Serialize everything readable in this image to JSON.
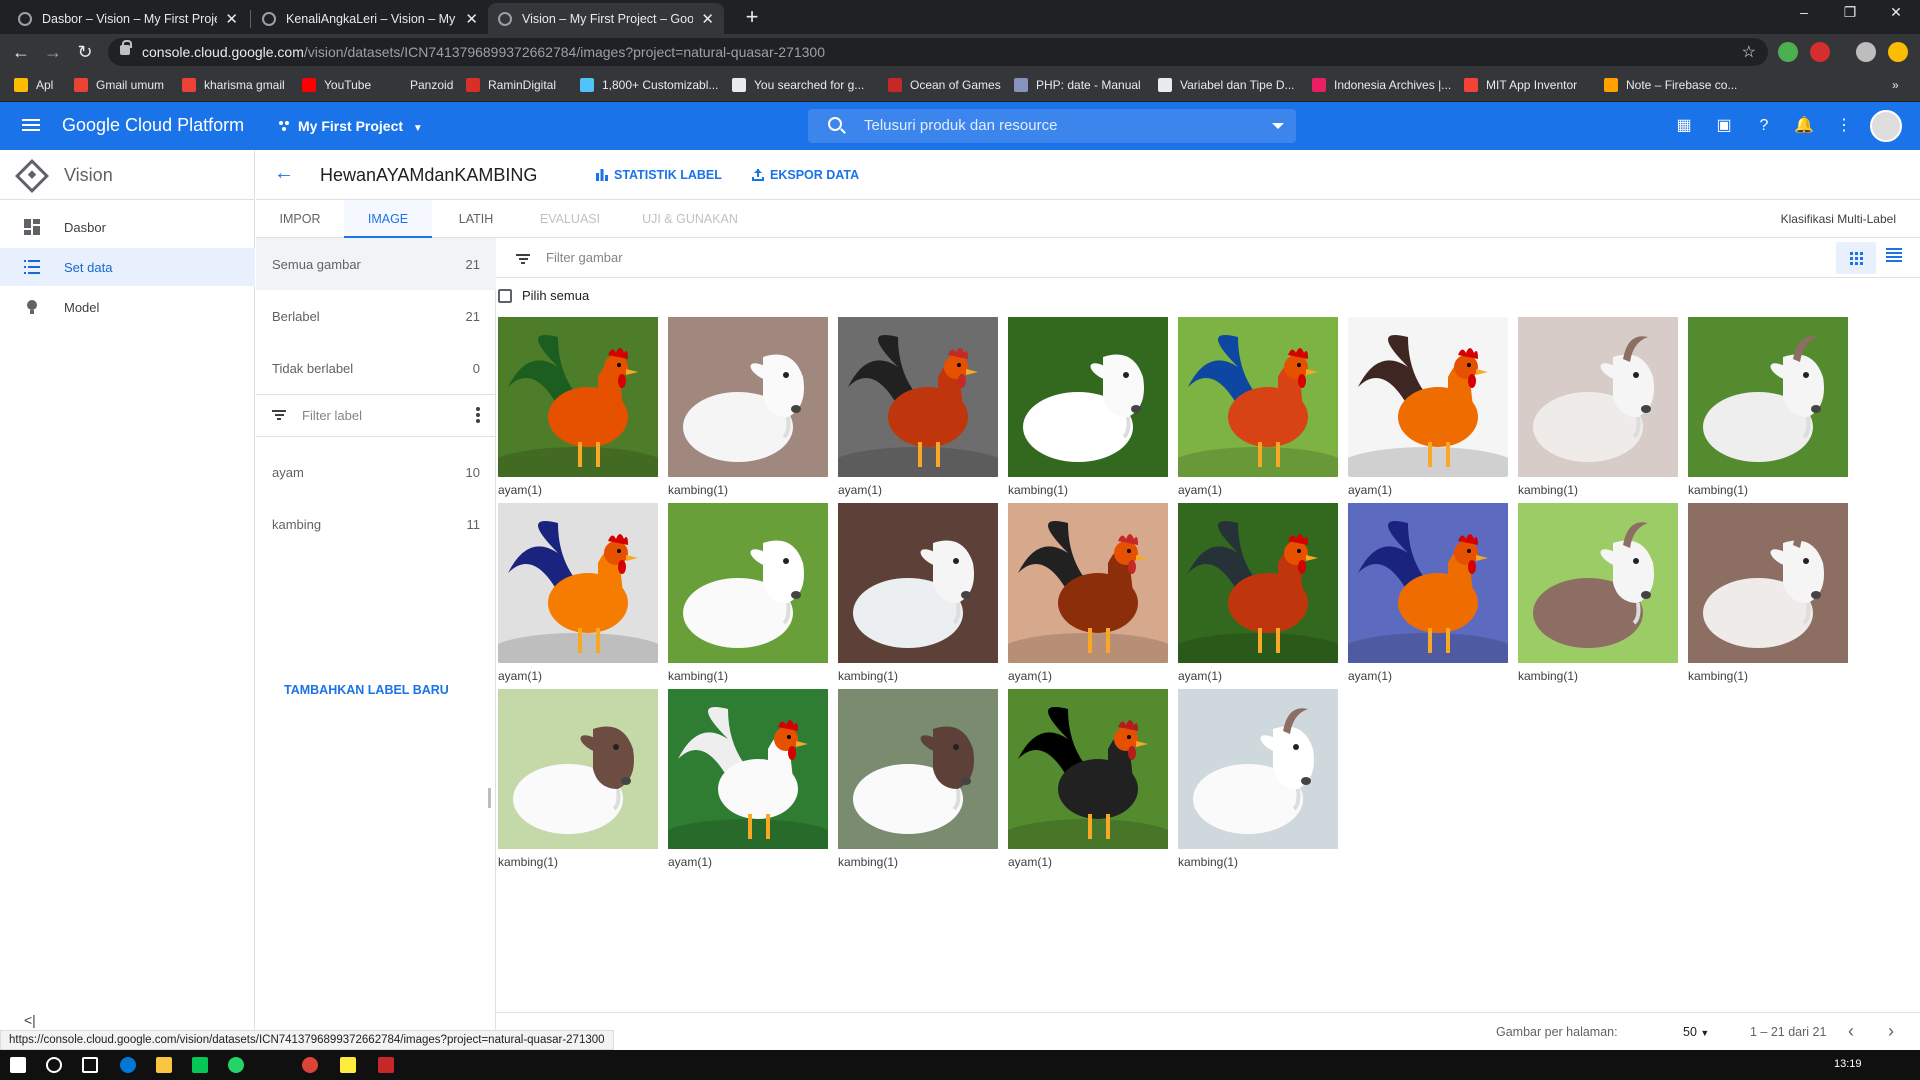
{
  "browser": {
    "tabs": [
      {
        "title": "Dasbor – Vision – My First Projec",
        "close": "✕"
      },
      {
        "title": "KenaliAngkaLeri – Vision – My Fir",
        "close": "✕"
      },
      {
        "title": "Vision – My First Project – Googl",
        "close": "✕"
      }
    ],
    "new_tab": "+",
    "window_controls": {
      "minimize": "–",
      "restore": "❐",
      "close": "✕"
    },
    "url_host": "console.cloud.google.com",
    "url_path": "/vision/datasets/ICN7413796899372662784/images?project=natural-quasar-271300",
    "bookmarks": [
      {
        "label": "Apl",
        "color": "#fbbc04"
      },
      {
        "label": "Gmail umum",
        "color": "#ea4335"
      },
      {
        "label": "kharisma gmail",
        "color": "#ea4335"
      },
      {
        "label": "YouTube",
        "color": "#ff0000"
      },
      {
        "label": "Panzoid",
        "color": "#35363a"
      },
      {
        "label": "RaminDigital",
        "color": "#d93025"
      },
      {
        "label": "1,800+ Customizabl...",
        "color": "#4fc3f7"
      },
      {
        "label": "You searched for g...",
        "color": "#e8eaed"
      },
      {
        "label": "Ocean of Games",
        "color": "#c62828"
      },
      {
        "label": "PHP: date - Manual",
        "color": "#8892bf"
      },
      {
        "label": "Variabel dan Tipe D...",
        "color": "#e8eaed"
      },
      {
        "label": "Indonesia Archives |...",
        "color": "#e91e63"
      },
      {
        "label": "MIT App Inventor",
        "color": "#f44336"
      },
      {
        "label": "Note – Firebase co...",
        "color": "#ffa000"
      }
    ],
    "bookmarks_more": "»"
  },
  "appbar": {
    "title": "Google Cloud Platform",
    "project": "My First Project",
    "search_placeholder": "Telusuri produk dan resource"
  },
  "sidebar": {
    "title": "Vision",
    "items": [
      {
        "label": "Dasbor"
      },
      {
        "label": "Set data"
      },
      {
        "label": "Model"
      }
    ],
    "collapse": "<|"
  },
  "dataset": {
    "title": "HewanAYAMdanKAMBING",
    "stat_label": "STATISTIK LABEL",
    "export_label": "EKSPOR DATA",
    "tabs": [
      "IMPOR",
      "IMAGE",
      "LATIH",
      "EVALUASI",
      "UJI & GUNAKAN"
    ],
    "classification": "Klasifikasi Multi-Label"
  },
  "leftpanel": {
    "all": {
      "label": "Semua gambar",
      "count": "21"
    },
    "labeled": {
      "label": "Berlabel",
      "count": "21"
    },
    "unlabeled": {
      "label": "Tidak berlabel",
      "count": "0"
    },
    "filter_placeholder": "Filter label",
    "labels": [
      {
        "label": "ayam",
        "count": "10"
      },
      {
        "label": "kambing",
        "count": "11"
      }
    ],
    "add_label": "TAMBAHKAN LABEL BARU"
  },
  "grid": {
    "filter_placeholder": "Filter gambar",
    "select_all": "Pilih semua",
    "images": [
      {
        "label": "ayam(1)",
        "kind": "rooster-red"
      },
      {
        "label": "kambing(1)",
        "kind": "goat-face"
      },
      {
        "label": "ayam(1)",
        "kind": "rooster-dark"
      },
      {
        "label": "kambing(1)",
        "kind": "goat-white-green"
      },
      {
        "label": "ayam(1)",
        "kind": "rooster-grass"
      },
      {
        "label": "ayam(1)",
        "kind": "rooster-orange"
      },
      {
        "label": "kambing(1)",
        "kind": "goat-grass"
      },
      {
        "label": "kambing(1)",
        "kind": "goat-horn"
      },
      {
        "label": "ayam(1)",
        "kind": "rooster-closeup"
      },
      {
        "label": "kambing(1)",
        "kind": "goat-white-field"
      },
      {
        "label": "kambing(1)",
        "kind": "goat-spotted"
      },
      {
        "label": "ayam(1)",
        "kind": "rooster-brown"
      },
      {
        "label": "ayam(1)",
        "kind": "rooster-bush"
      },
      {
        "label": "ayam(1)",
        "kind": "rooster-blue"
      },
      {
        "label": "kambing(1)",
        "kind": "goat-brown"
      },
      {
        "label": "kambing(1)",
        "kind": "goat-shaggy"
      },
      {
        "label": "kambing(1)",
        "kind": "goat-boer"
      },
      {
        "label": "ayam(1)",
        "kind": "hen-white"
      },
      {
        "label": "kambing(1)",
        "kind": "goat-boer-field"
      },
      {
        "label": "ayam(1)",
        "kind": "rooster-black"
      },
      {
        "label": "kambing(1)",
        "kind": "goat-white-face"
      }
    ]
  },
  "pager": {
    "per_page_label": "Gambar per halaman:",
    "per_page": "50",
    "range": "1 – 21 dari 21"
  },
  "status_url": "https://console.cloud.google.com/vision/datasets/ICN7413796899372662784/images?project=natural-quasar-271300",
  "clock": "13:19"
}
